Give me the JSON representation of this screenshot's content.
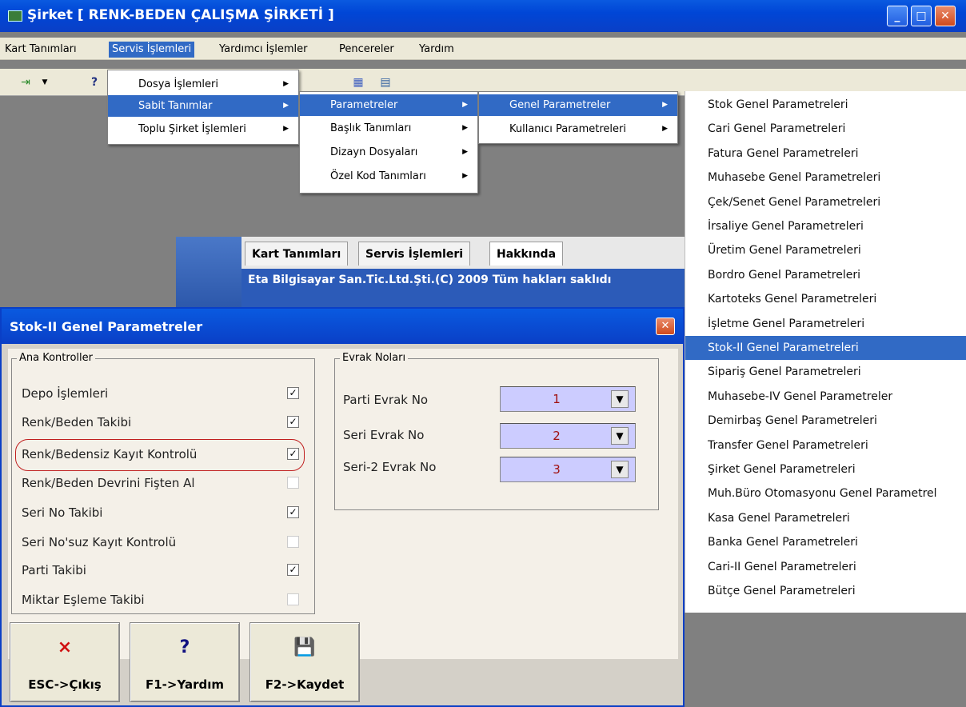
{
  "window": {
    "title": "Şirket [ RENK-BEDEN ÇALIŞMA ŞİRKETİ ]",
    "controls": {
      "minimize": "_",
      "maximize": "□",
      "close": "✕"
    }
  },
  "menubar": {
    "items": [
      "Kart Tanımları",
      "Servis İşlemleri",
      "Yardımcı İşlemler",
      "Pencereler",
      "Yardım"
    ],
    "active": "Servis İşlemleri"
  },
  "servis_menu": {
    "items": [
      "Dosya İşlemleri",
      "Sabit Tanımlar",
      "Toplu Şirket İşlemleri"
    ],
    "selected": "Sabit Tanımlar"
  },
  "sabit_menu": {
    "items": [
      "Parametreler",
      "Başlık Tanımları",
      "Dizayn Dosyaları",
      "Özel Kod Tanımları"
    ],
    "selected": "Parametreler"
  },
  "parametreler_menu": {
    "items": [
      "Genel Parametreler",
      "Kullanıcı Parametreleri"
    ],
    "selected": "Genel Parametreler"
  },
  "genel_parametreler_list": {
    "items": [
      "Stok Genel Parametreleri",
      "Cari Genel Parametreleri",
      "Fatura Genel Parametreleri",
      "Muhasebe Genel Parametreleri",
      "Çek/Senet Genel Parametreleri",
      "İrsaliye Genel Parametreleri",
      "Üretim Genel Parametreleri",
      "Bordro Genel Parametreleri",
      "Kartoteks  Genel Parametreleri",
      "İşletme Genel Parametreleri",
      "Stok-II Genel Parametreleri",
      "Sipariş Genel Parametreleri",
      "Muhasebe-IV Genel Parametreler",
      "Demirbaş Genel Parametreleri",
      "Transfer Genel Parametreleri",
      "Şirket Genel Parametreleri",
      "Muh.Büro Otomasyonu Genel Parametrel",
      "Kasa Genel Parametreleri",
      "Banka  Genel Parametreleri",
      "Cari-II Genel Parametreleri",
      "Bütçe Genel Parametreleri"
    ],
    "selected": "Stok-II Genel Parametreleri"
  },
  "background_window": {
    "tabs": [
      "Kart Tanımları",
      "Servis İşlemleri",
      "Hakkında"
    ],
    "status": "Eta Bilgisayar San.Tic.Ltd.Şti.(C) 2009 Tüm hakları saklıdı"
  },
  "dialog": {
    "title": "Stok-II Genel Parametreler",
    "close": "✕",
    "ana_kontroller": {
      "label": "Ana Kontroller",
      "items": [
        {
          "label": "Depo İşlemleri",
          "checked": true
        },
        {
          "label": "Renk/Beden Takibi",
          "checked": true
        },
        {
          "label": "Renk/Bedensiz Kayıt Kontrolü",
          "checked": true
        },
        {
          "label": "Renk/Beden Devrini Fişten Al",
          "checked": false
        },
        {
          "label": "Seri No Takibi",
          "checked": true
        },
        {
          "label": "Seri No'suz Kayıt Kontrolü",
          "checked": false
        },
        {
          "label": "Parti Takibi",
          "checked": true
        },
        {
          "label": "Miktar Eşleme Takibi",
          "checked": false
        }
      ]
    },
    "evrak_nolari": {
      "label": "Evrak Noları",
      "items": [
        {
          "label": "Parti Evrak No",
          "value": "1"
        },
        {
          "label": "Seri Evrak No",
          "value": "2"
        },
        {
          "label": "Seri-2 Evrak No",
          "value": "3"
        }
      ]
    },
    "buttons": [
      {
        "label": "ESC->Çıkış",
        "icon": "×"
      },
      {
        "label": "F1->Yardım",
        "icon": "?"
      },
      {
        "label": "F2->Kaydet",
        "icon": "💾"
      }
    ]
  },
  "colors": {
    "selection": "#316ac5",
    "title_bar": "#0a4fd8",
    "field_bg": "#ccccff"
  }
}
